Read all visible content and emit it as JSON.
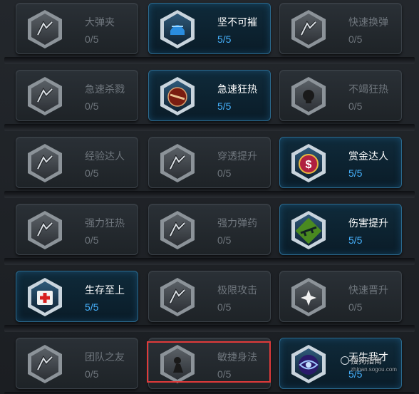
{
  "perks": [
    [
      {
        "name": "大弹夹",
        "count": "0/5",
        "active": false,
        "icon": "magazine-icon"
      },
      {
        "name": "坚不可摧",
        "count": "5/5",
        "active": true,
        "icon": "armor-helmet-icon"
      },
      {
        "name": "快速换弹",
        "count": "0/5",
        "active": false,
        "icon": "reload-hand-icon"
      }
    ],
    [
      {
        "name": "急速杀戮",
        "count": "0/5",
        "active": false,
        "icon": "fist-icon"
      },
      {
        "name": "急速狂热",
        "count": "5/5",
        "active": true,
        "icon": "frenzy-icon"
      },
      {
        "name": "不竭狂热",
        "count": "0/5",
        "active": false,
        "icon": "skull-icon"
      }
    ],
    [
      {
        "name": "经验达人",
        "count": "0/5",
        "active": false,
        "icon": "exp-plus-icon"
      },
      {
        "name": "穿透提升",
        "count": "0/5",
        "active": false,
        "icon": "penetration-icon"
      },
      {
        "name": "赏金达人",
        "count": "5/5",
        "active": true,
        "icon": "money-icon"
      }
    ],
    [
      {
        "name": "强力狂热",
        "count": "0/5",
        "active": false,
        "icon": "power-frenzy-icon"
      },
      {
        "name": "强力弹药",
        "count": "0/5",
        "active": false,
        "icon": "power-ammo-icon"
      },
      {
        "name": "伤害提升",
        "count": "5/5",
        "active": true,
        "icon": "rifle-damage-icon"
      }
    ],
    [
      {
        "name": "生存至上",
        "count": "5/5",
        "active": true,
        "icon": "medkit-icon"
      },
      {
        "name": "极限攻击",
        "count": "0/5",
        "active": false,
        "icon": "extreme-attack-icon"
      },
      {
        "name": "快速晋升",
        "count": "0/5",
        "active": false,
        "icon": "burst-icon"
      }
    ],
    [
      {
        "name": "团队之友",
        "count": "0/5",
        "active": false,
        "icon": "team-rifle-icon"
      },
      {
        "name": "敏捷身法",
        "count": "0/5",
        "active": false,
        "icon": "agility-icon"
      },
      {
        "name": "天生我才",
        "count": "5/5",
        "active": true,
        "icon": "eye-icon"
      }
    ]
  ],
  "watermark": {
    "text": "搜狗指南",
    "sub": "zhinan.sogou.com"
  },
  "colors": {
    "active_count": "#47b3ff",
    "inactive_text": "#6f767d",
    "highlight": "#e03a3a"
  }
}
